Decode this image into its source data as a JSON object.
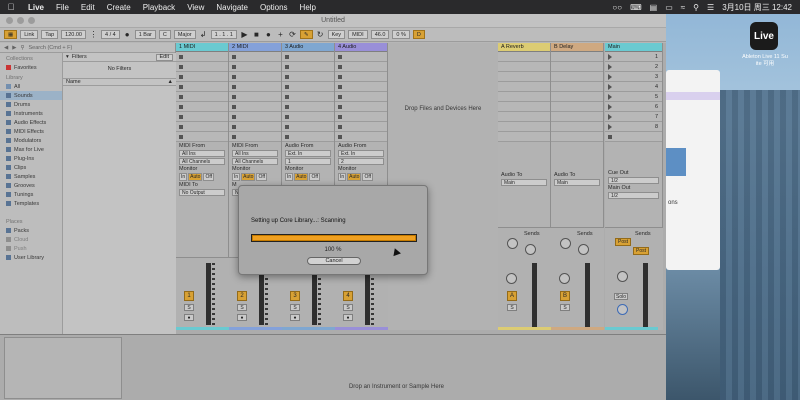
{
  "menubar": {
    "app": "Live",
    "items": [
      "File",
      "Edit",
      "Create",
      "Playback",
      "View",
      "Navigate",
      "Options",
      "Help"
    ],
    "clock": "3月10日 周三 12:42"
  },
  "desktop": {
    "icon_label": "Live",
    "icon_caption_1": "Ableton Live 11 Su",
    "icon_caption_2": "ite 可用",
    "window_text": "ons"
  },
  "window": {
    "title": "Untitled"
  },
  "transport": {
    "link": "Link",
    "tap": "Tap",
    "tempo": "120.00",
    "signature": "4 / 4",
    "quantize": "1 Bar",
    "key": "C",
    "scale": "Major",
    "position": "1 .  1 .  1",
    "key_btn": "Key",
    "midi_btn": "MIDI",
    "cpu": "46.0",
    "cpu_pct": "0 %",
    "mode_icon": "D"
  },
  "browser": {
    "search_placeholder": "Search (Cmd + F)",
    "collections_head": "Collections",
    "favorites": "Favorites",
    "library_head": "Library",
    "library": [
      "All",
      "Sounds",
      "Drums",
      "Instruments",
      "Audio Effects",
      "MIDI Effects",
      "Modulators",
      "Max for Live",
      "Plug-Ins",
      "Clips",
      "Samples",
      "Grooves",
      "Tunings",
      "Templates"
    ],
    "places_head": "Places",
    "places": [
      "Packs",
      "Cloud",
      "Push",
      "User Library"
    ],
    "filters_label": "Filters",
    "edit_btn": "Edit",
    "no_filters": "No Filters",
    "name_col": "Name"
  },
  "tracks": [
    {
      "name": "1 MIDI",
      "color": "#6fe0e8",
      "kind": "midi",
      "from_label": "MIDI From",
      "from": "All Ins",
      "channel": "All Channels",
      "monitor": "Monitor",
      "to_label": "MIDI To",
      "to": "No Output",
      "number": "1"
    },
    {
      "name": "2 MIDI",
      "color": "#8db0f2",
      "kind": "midi",
      "from_label": "MIDI From",
      "from": "All Ins",
      "channel": "All Channels",
      "monitor": "Monitor",
      "to_label": "M",
      "to": "N",
      "number": "2"
    },
    {
      "name": "3 Audio",
      "color": "#88b7e8",
      "kind": "audio",
      "from_label": "Audio From",
      "from": "Ext. In",
      "channel": "1",
      "monitor": "Monitor",
      "to_label": "",
      "to": "",
      "number": "3"
    },
    {
      "name": "4 Audio",
      "color": "#a69af0",
      "kind": "audio",
      "from_label": "Audio From",
      "from": "Ext. In",
      "channel": "2",
      "monitor": "Monitor",
      "to_label": "",
      "to": "",
      "number": "4"
    }
  ],
  "monitor_btns": [
    "In",
    "Auto",
    "Off"
  ],
  "mixer_btns": {
    "solo": "S",
    "arm": "●"
  },
  "drop_area_msg": "Drop Files and Devices Here",
  "returns": [
    {
      "name": "A Reverb",
      "color": "#f5e27a",
      "to_label": "Audio To",
      "to": "Main",
      "sends": "Sends",
      "letter": "A",
      "solo": "S"
    },
    {
      "name": "B Delay",
      "color": "#e6b98a",
      "to_label": "Audio To",
      "to": "Main",
      "sends": "Sends",
      "letter": "B",
      "solo": "S"
    }
  ],
  "main": {
    "name": "Main",
    "color": "#6fe0e8",
    "scenes": [
      "1",
      "2",
      "3",
      "4",
      "5",
      "6",
      "7",
      "8"
    ],
    "cue_label": "Cue Out",
    "cue": "1/2",
    "out_label": "Main Out",
    "out": "1/2",
    "sends": "Sends",
    "post1": "Post",
    "post2": "Post",
    "solo": "Solo"
  },
  "meter_scale": [
    "0",
    "6",
    "12",
    "18",
    "24",
    "30",
    "36",
    "48",
    "60"
  ],
  "detail_msg": "Drop an Instrument or Sample Here",
  "dialog": {
    "status": "Setting up Core Library...: Scanning",
    "progress": 1.0,
    "percent": "100 %",
    "cancel": "Cancel"
  }
}
